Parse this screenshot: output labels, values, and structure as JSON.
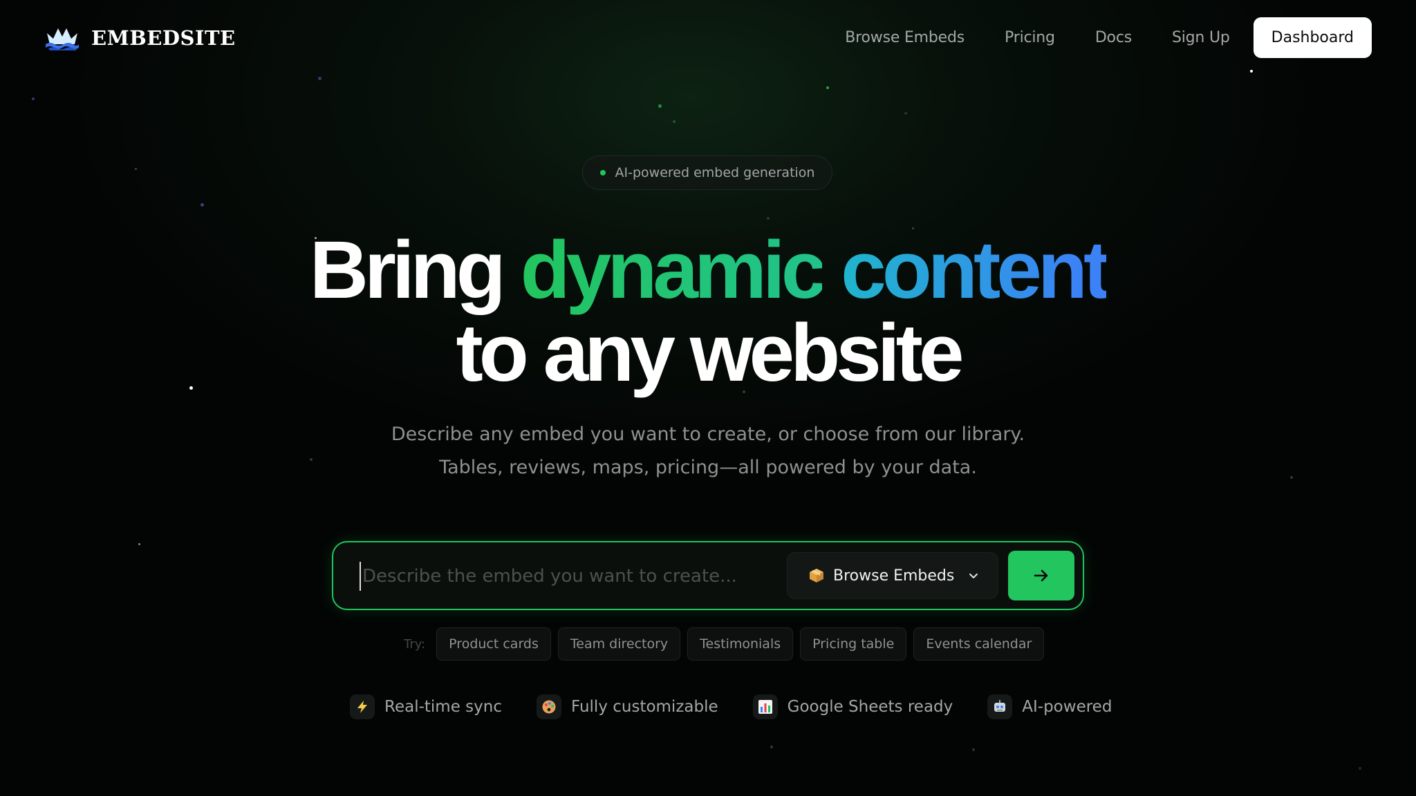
{
  "header": {
    "brand": "EMBEDSITE",
    "nav": [
      "Browse Embeds",
      "Pricing",
      "Docs",
      "Sign Up"
    ],
    "dashboard_label": "Dashboard"
  },
  "badge": {
    "text": "AI-powered embed generation"
  },
  "hero": {
    "line1_word1": "Bring",
    "line1_word2": "dynamic",
    "line1_word3": "content",
    "line2": "to any website",
    "subtitle1": "Describe any embed you want to create, or choose from our library.",
    "subtitle2": "Tables, reviews, maps, pricing—all powered by your data."
  },
  "prompt": {
    "placeholder": "Describe the embed you want to create...",
    "value": "",
    "select_label": "Browse Embeds",
    "select_icon": "package-icon",
    "submit_icon": "arrow-right-icon"
  },
  "try": {
    "label": "Try:",
    "chips": [
      "Product cards",
      "Team directory",
      "Testimonials",
      "Pricing table",
      "Events calendar"
    ]
  },
  "features": [
    {
      "icon": "lightning-icon",
      "glyph": "⚡",
      "label": "Real-time sync"
    },
    {
      "icon": "palette-icon",
      "glyph": "🎨",
      "label": "Fully customizable"
    },
    {
      "icon": "chart-icon",
      "glyph": "📊",
      "label": "Google Sheets ready"
    },
    {
      "icon": "robot-icon",
      "glyph": "🤖",
      "label": "AI-powered"
    }
  ],
  "colors": {
    "accent": "#22c55e",
    "gradient_start": "#22c55e",
    "gradient_mid": "#1fb5cc",
    "gradient_end": "#3b82f6",
    "background": "#040605"
  }
}
